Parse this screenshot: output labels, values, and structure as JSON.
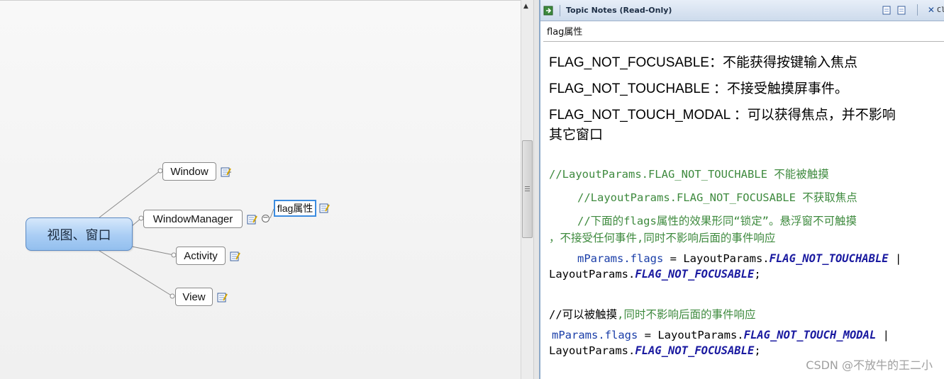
{
  "map": {
    "central": "视图、窗口",
    "branches": [
      "Window",
      "WindowManager",
      "Activity",
      "View"
    ],
    "sub_topic": "flag属性",
    "collapse_glyph": "−"
  },
  "panel": {
    "title": "Topic Notes (Read-Only)",
    "close_label": "Cl",
    "topic_title": "flag属性"
  },
  "notes": {
    "l1": "FLAG_NOT_FOCUSABLE：不能获得按键输入焦点",
    "l2": "FLAG_NOT_TOUCHABLE ：不接受触摸屏事件。",
    "l3a": "FLAG_NOT_TOUCH_MODAL ：可以获得焦点，并不影响",
    "l3b": "其它窗口",
    "c1": "//LayoutParams.FLAG_NOT_TOUCHABLE 不能被触摸",
    "c2": "//LayoutParams.FLAG_NOT_FOCUSABLE 不获取焦点",
    "c3a": "//下面的flags属性的效果形同“锁定”。悬浮窗不可触摸",
    "c3b": "，不接受任何事件,同时不影响后面的事件响应",
    "code1": {
      "field": "mParams.flags",
      "eq": " = LayoutParams.",
      "const1": "FLAG_NOT_TOUCHABLE",
      "pipe": " |",
      "prefix2": "LayoutParams.",
      "const2": "FLAG_NOT_FOCUSABLE",
      "semi": ";"
    },
    "c4a": "//可以被触摸",
    "c4b": ",同时不影响后面的事件响应",
    "code2": {
      "field": "mParams.flags",
      "eq": " = LayoutParams.",
      "const1": "FLAG_NOT_TOUCH_MODAL",
      "pipe": " |",
      "prefix2": "LayoutParams.",
      "const2": "FLAG_NOT_FOCUSABLE",
      "semi": ";"
    }
  },
  "watermark": "CSDN @不放牛的王二小",
  "icons": {
    "note": "note-icon",
    "export": "export-icon",
    "close": "close-icon"
  }
}
